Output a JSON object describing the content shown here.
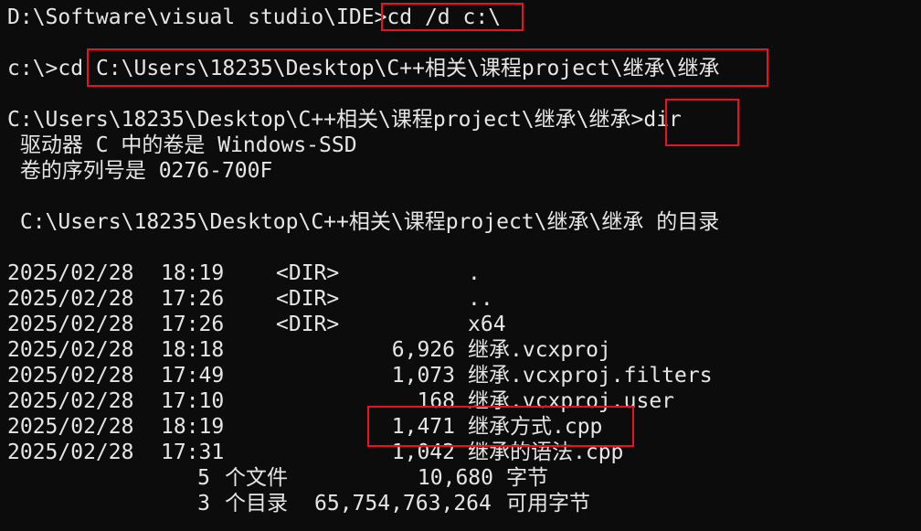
{
  "terminal": {
    "lines": [
      {
        "prompt": "D:\\Software\\visual studio\\IDE>",
        "command": "cd /d c:\\"
      },
      {
        "prompt": "c:\\>cd",
        "command": " C:\\Users\\18235\\Desktop\\C++相关\\课程project\\继承\\继承"
      },
      {
        "prompt": "C:\\Users\\18235\\Desktop\\C++相关\\课程project\\继承\\继承",
        "command": ">dir"
      }
    ],
    "volume_label": " 驱动器 C 中的卷是 Windows-SSD",
    "volume_serial": " 卷的序列号是 0276-700F",
    "directory_of": " C:\\Users\\18235\\Desktop\\C++相关\\课程project\\继承\\继承 的目录",
    "entries": [
      {
        "date": "2025/02/28",
        "time": "18:19",
        "type": "<DIR>",
        "size": "",
        "name": "."
      },
      {
        "date": "2025/02/28",
        "time": "17:26",
        "type": "<DIR>",
        "size": "",
        "name": ".."
      },
      {
        "date": "2025/02/28",
        "time": "17:26",
        "type": "<DIR>",
        "size": "",
        "name": "x64"
      },
      {
        "date": "2025/02/28",
        "time": "18:18",
        "type": "",
        "size": "6,926",
        "name": "继承.vcxproj"
      },
      {
        "date": "2025/02/28",
        "time": "17:49",
        "type": "",
        "size": "1,073",
        "name": "继承.vcxproj.filters"
      },
      {
        "date": "2025/02/28",
        "time": "17:10",
        "type": "",
        "size": "168",
        "name": "继承.vcxproj.user"
      },
      {
        "date": "2025/02/28",
        "time": "18:19",
        "type": "",
        "size": "1,471",
        "name": "继承方式.cpp"
      },
      {
        "date": "2025/02/28",
        "time": "17:31",
        "type": "",
        "size": "1,042",
        "name": "继承的语法.cpp"
      }
    ],
    "summary": {
      "files_count": "5",
      "files_label": "个文件",
      "files_bytes": "10,680",
      "bytes_label": "字节",
      "dirs_count": "3",
      "dirs_label": "个目录",
      "free_bytes": "65,754,763,264",
      "free_label": "可用字节"
    }
  },
  "colors": {
    "background": "#0c0c0c",
    "text": "#e6e6e6",
    "highlight": "#e81224"
  }
}
